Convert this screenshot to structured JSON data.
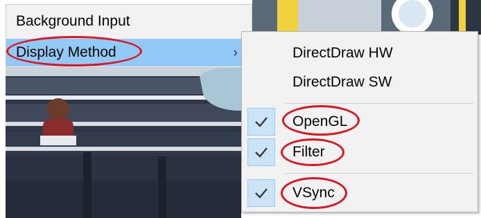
{
  "parent_menu": {
    "items": [
      {
        "label": "Background Input"
      },
      {
        "label": "Display Method",
        "submenu_arrow": "›",
        "highlighted": true
      }
    ]
  },
  "submenu": {
    "items": [
      {
        "label": "DirectDraw HW",
        "checked": false
      },
      {
        "label": "DirectDraw SW",
        "checked": false
      },
      {
        "label": "OpenGL",
        "checked": true,
        "annotated": true
      },
      {
        "label": "Filter",
        "checked": true,
        "annotated": true
      },
      {
        "label": "VSync",
        "checked": true,
        "annotated": true
      }
    ],
    "check_glyph": "checkmark-icon"
  },
  "colors": {
    "menu_bg": "#f2f2f2",
    "highlight": "#91c9f7",
    "check_bg": "#cce4f7",
    "annotation_red": "#e0141e"
  }
}
